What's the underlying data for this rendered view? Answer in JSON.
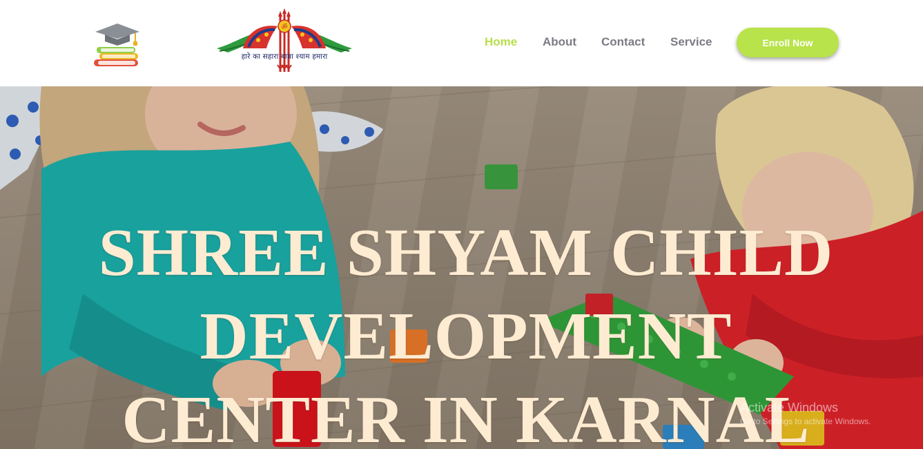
{
  "header": {
    "logo_caption": "हारे का सहारा बाबा श्याम हमारा",
    "nav": [
      {
        "label": "Home",
        "active": true
      },
      {
        "label": "About",
        "active": false
      },
      {
        "label": "Contact",
        "active": false
      },
      {
        "label": "Service",
        "active": false
      }
    ],
    "enroll_label": "Enroll Now"
  },
  "hero": {
    "title_lines": [
      "SHREE SHYAM CHILD",
      "DEVELOPMENT",
      "CENTER IN KARNAL"
    ]
  },
  "watermark": {
    "title": "Activate Windows",
    "subtitle": "Go to Settings to activate Windows."
  },
  "colors": {
    "accent_green": "#b8e34a",
    "nav_text": "#7b7b85",
    "hero_title": "#fdebd2"
  },
  "icons": {
    "site_logo": "books-graduation-cap-icon",
    "brand_logo": "khatu-shyam-emblem-icon"
  }
}
